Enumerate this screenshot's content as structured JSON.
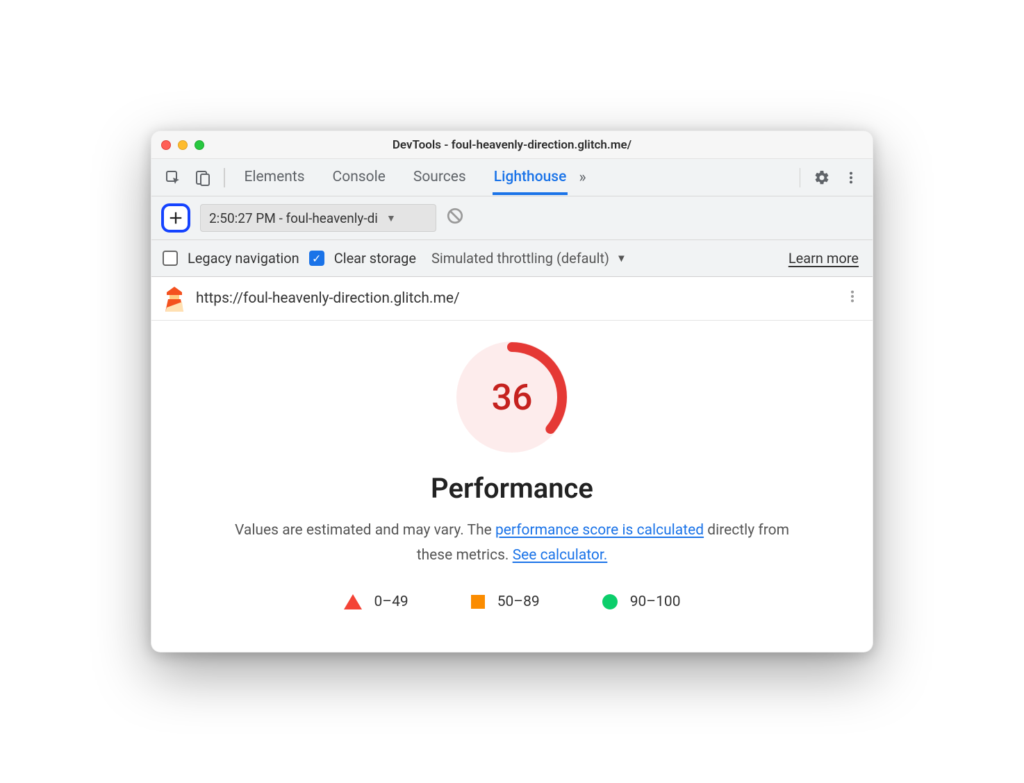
{
  "window": {
    "title": "DevTools - foul-heavenly-direction.glitch.me/"
  },
  "tabs": {
    "items": [
      {
        "label": "Elements",
        "active": false
      },
      {
        "label": "Console",
        "active": false
      },
      {
        "label": "Sources",
        "active": false
      },
      {
        "label": "Lighthouse",
        "active": true
      }
    ]
  },
  "lh_toolbar": {
    "report_label": "2:50:27 PM - foul-heavenly-di"
  },
  "options": {
    "legacy_label": "Legacy navigation",
    "legacy_checked": false,
    "clear_label": "Clear storage",
    "clear_checked": true,
    "throttling_label": "Simulated throttling (default)",
    "learn_more": "Learn more"
  },
  "url_row": {
    "url": "https://foul-heavenly-direction.glitch.me/"
  },
  "score": {
    "value": "36",
    "title": "Performance",
    "desc_prefix": "Values are estimated and may vary. The ",
    "link1": "performance score is calculated",
    "desc_mid": " directly from these metrics. ",
    "link2": "See calculator."
  },
  "legend": {
    "r1": "0–49",
    "r2": "50–89",
    "r3": "90–100"
  }
}
